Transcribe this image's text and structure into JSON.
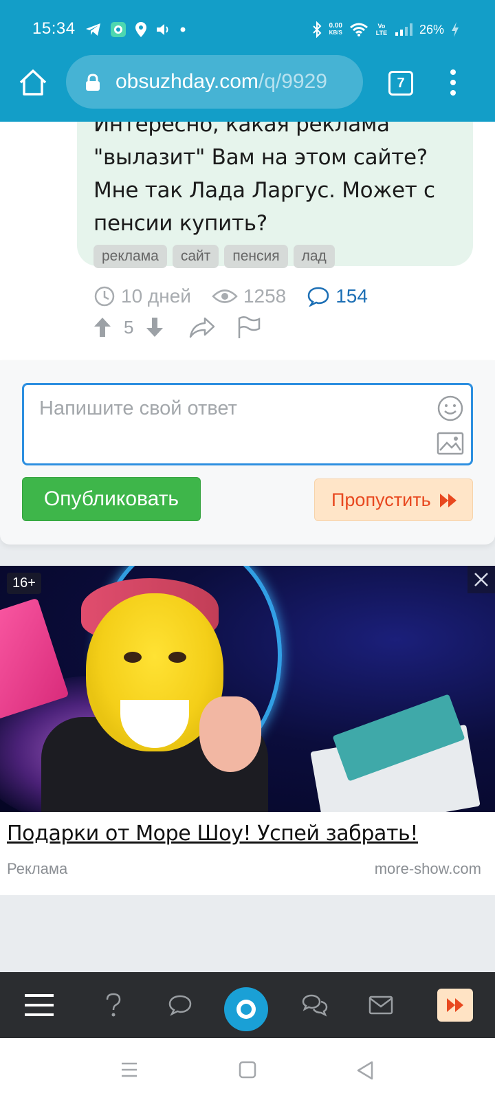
{
  "status_bar": {
    "time": "15:34",
    "net_speed_value": "0.00",
    "net_speed_unit": "KB/S",
    "volte": "Vo LTE",
    "battery": "26%"
  },
  "browser": {
    "url_host": "obsuzhday.com",
    "url_path": "/q/9929",
    "tab_count": "7"
  },
  "question": {
    "text": "Интересно, какая реклама \"вылазит\" Вам на этом сайте? Мне так Лада Ларгус. Может с пенсии купить?",
    "tags": [
      "реклама",
      "сайт",
      "пенсия",
      "лад"
    ],
    "age": "10 дней",
    "views": "1258",
    "comments": "154",
    "votes": "5"
  },
  "answer": {
    "placeholder": "Напишите свой ответ",
    "publish_label": "Опубликовать",
    "skip_label": "Пропустить"
  },
  "ad": {
    "age_rating": "16+",
    "title": "Подарки от Море Шоу! Успей забрать!",
    "label": "Реклама",
    "domain": "more-show.com"
  },
  "colors": {
    "header": "#139ec8",
    "bubble": "#e6f4ec",
    "publish": "#3eb64a",
    "skip_bg": "#ffe5c8",
    "skip_text": "#e8481f",
    "link_blue": "#1c6fb5",
    "bottom_nav": "#2b2d30"
  },
  "icons": {
    "status_left": [
      "telegram-icon",
      "app-icon",
      "location-icon",
      "volume-icon",
      "dot-icon"
    ],
    "status_right": [
      "bluetooth-icon",
      "wifi-icon",
      "signal-icon",
      "charging-icon"
    ],
    "bottom_nav": [
      "menu-icon",
      "question-icon",
      "chat-icon",
      "home-logo-icon",
      "discussions-icon",
      "mail-icon",
      "skip-icon"
    ],
    "system_nav": [
      "recents-icon",
      "home-icon",
      "back-icon"
    ]
  }
}
